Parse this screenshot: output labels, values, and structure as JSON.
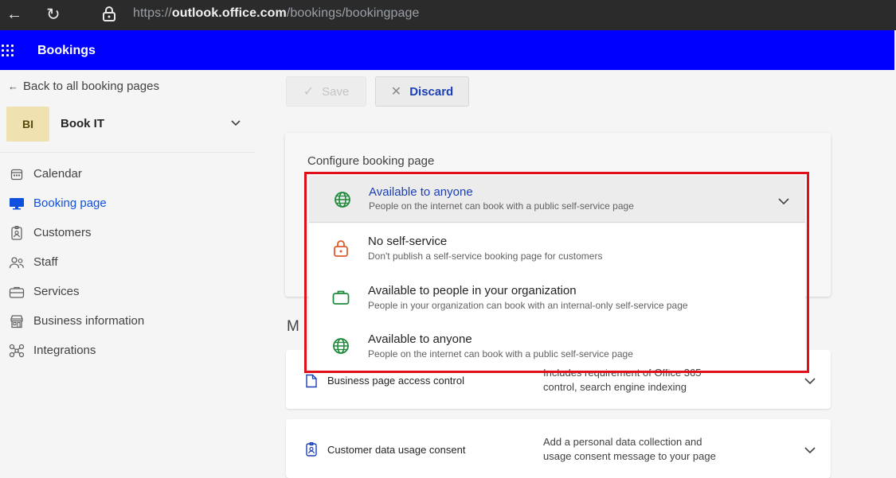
{
  "browser": {
    "url_prefix": "https://",
    "url_domain": "outlook.office.com",
    "url_path": "/bookings/bookingpage"
  },
  "app": {
    "title": "Bookings"
  },
  "sidebar": {
    "back_label": "Back to all booking pages",
    "page": {
      "initials": "BI",
      "name": "Book IT"
    },
    "items": [
      {
        "label": "Calendar",
        "icon": "calendar-icon"
      },
      {
        "label": "Booking page",
        "icon": "monitor-icon",
        "active": true
      },
      {
        "label": "Customers",
        "icon": "contact-card-icon"
      },
      {
        "label": "Staff",
        "icon": "people-icon"
      },
      {
        "label": "Services",
        "icon": "briefcase-icon"
      },
      {
        "label": "Business information",
        "icon": "building-icon"
      },
      {
        "label": "Integrations",
        "icon": "integrations-icon"
      }
    ]
  },
  "toolbar": {
    "save_label": "Save",
    "discard_label": "Discard"
  },
  "configure": {
    "title": "Configure booking page",
    "selected": {
      "title": "Available to anyone",
      "description": "People on the internet can book with a public self-service page",
      "icon": "globe-icon"
    },
    "options": [
      {
        "title": "No self-service",
        "description": "Don't publish a self-service booking page for customers",
        "icon": "lock-icon",
        "color": "#e05a2b"
      },
      {
        "title": "Available to people in your organization",
        "description": "People in your organization can book with an internal-only self-service page",
        "icon": "briefcase-icon",
        "color": "#1f8a3a"
      },
      {
        "title": "Available to anyone",
        "description": "People on the internet can book with a public self-service page",
        "icon": "globe-icon",
        "color": "#1f8a3a"
      }
    ]
  },
  "section_heading_partial": "M",
  "settings": [
    {
      "label": "Business page access control",
      "description": "Includes requirement of Office 365",
      "description2": "control, search engine indexing",
      "icon": "page-icon"
    },
    {
      "label": "Customer data usage consent",
      "description": "Add a personal data collection and",
      "description2": "usage consent message to your page",
      "icon": "contact-badge-icon"
    }
  ],
  "colors": {
    "brand_header": "#0000ff",
    "accent": "#1a3fb6",
    "highlight_border": "#e0101a",
    "globe": "#1f8a3a",
    "lock": "#e05a2b"
  }
}
